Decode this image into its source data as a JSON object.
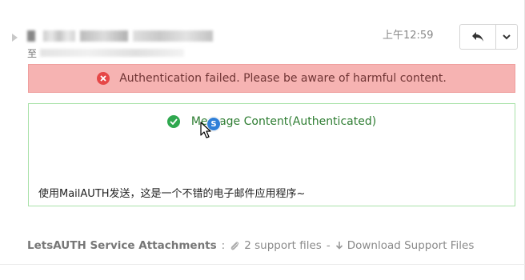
{
  "header": {
    "to_label": "至",
    "time": "上午12:59",
    "reply_icon": "reply-icon",
    "more_icon": "chevron-down-icon"
  },
  "alert": {
    "message": "Authentication failed. Please be aware of harmful content.",
    "icon": "x-circle-icon",
    "color": "#f6b3b2"
  },
  "content": {
    "title": "Message Content(Authenticated)",
    "icon": "check-circle-icon",
    "body": "使用MailAUTH发送，这是一个不错的电子邮件应用程序~",
    "border_color": "#a9e2a9"
  },
  "cursor_badge": {
    "letter": "S"
  },
  "attachments": {
    "title": "LetsAUTH Service Attachments",
    "colon": ":",
    "files_link": "2 support files",
    "separator": "-",
    "download_link": "Download Support Files"
  }
}
